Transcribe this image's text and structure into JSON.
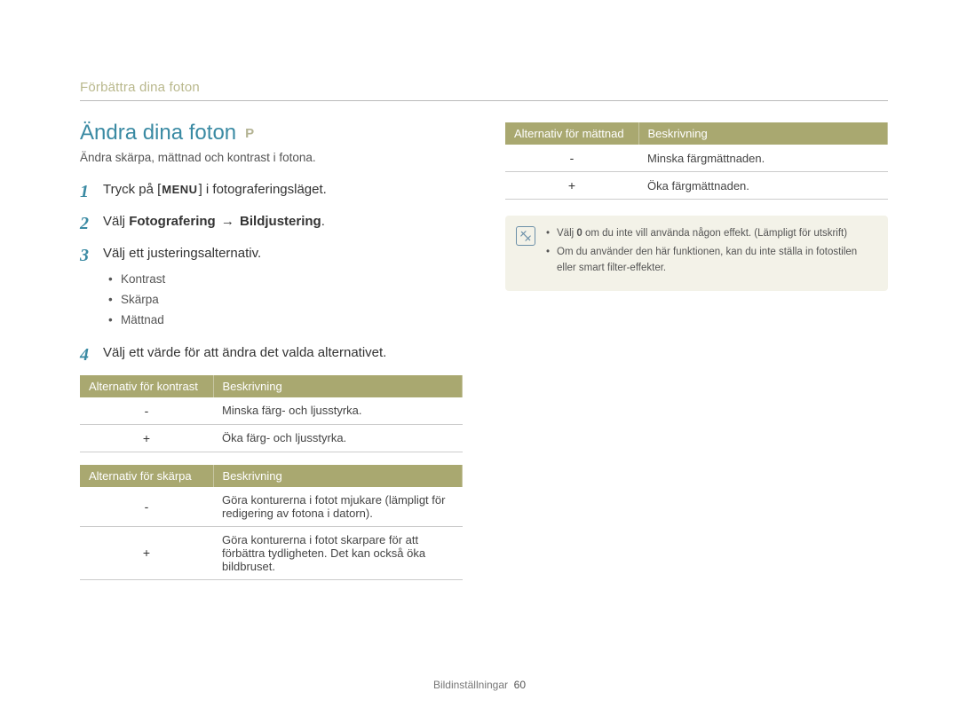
{
  "breadcrumb": "Förbättra dina foton",
  "title": "Ändra dina foton",
  "mode_badge": "P",
  "subtitle": "Ändra skärpa, mättnad och kontrast i fotona.",
  "steps": {
    "s1_a": "Tryck på [",
    "s1_key": "MENU",
    "s1_b": "] i fotograferingsläget.",
    "s2_a": "Välj ",
    "s2_b": "Fotografering",
    "s2_arrow": " → ",
    "s2_c": "Bildjustering",
    "s2_d": ".",
    "s3": "Välj ett justeringsalternativ.",
    "s3_items": [
      "Kontrast",
      "Skärpa",
      "Mättnad"
    ],
    "s4": "Välj ett värde för att ändra det valda alternativet."
  },
  "tables": {
    "kontrast": {
      "h1": "Alternativ för kontrast",
      "h2": "Beskrivning",
      "rows": [
        {
          "sym": "-",
          "desc": "Minska färg- och ljusstyrka."
        },
        {
          "sym": "+",
          "desc": "Öka färg- och ljusstyrka."
        }
      ]
    },
    "skarpa": {
      "h1": "Alternativ för skärpa",
      "h2": "Beskrivning",
      "rows": [
        {
          "sym": "-",
          "desc": "Göra konturerna i fotot mjukare (lämpligt för redigering av fotona i datorn)."
        },
        {
          "sym": "+",
          "desc": "Göra konturerna i fotot skarpare för att förbättra tydligheten. Det kan också öka bildbruset."
        }
      ]
    },
    "mattnad": {
      "h1": "Alternativ för mättnad",
      "h2": "Beskrivning",
      "rows": [
        {
          "sym": "-",
          "desc": "Minska färgmättnaden."
        },
        {
          "sym": "+",
          "desc": "Öka färgmättnaden."
        }
      ]
    }
  },
  "note": {
    "l1a": "Välj ",
    "l1b": "0",
    "l1c": " om du inte vill använda någon effekt. (Lämpligt för utskrift)",
    "l2": "Om du använder den här funktionen, kan du inte ställa in fotostilen eller smart filter-effekter."
  },
  "footer": {
    "section": "Bildinställningar",
    "page": "60"
  }
}
